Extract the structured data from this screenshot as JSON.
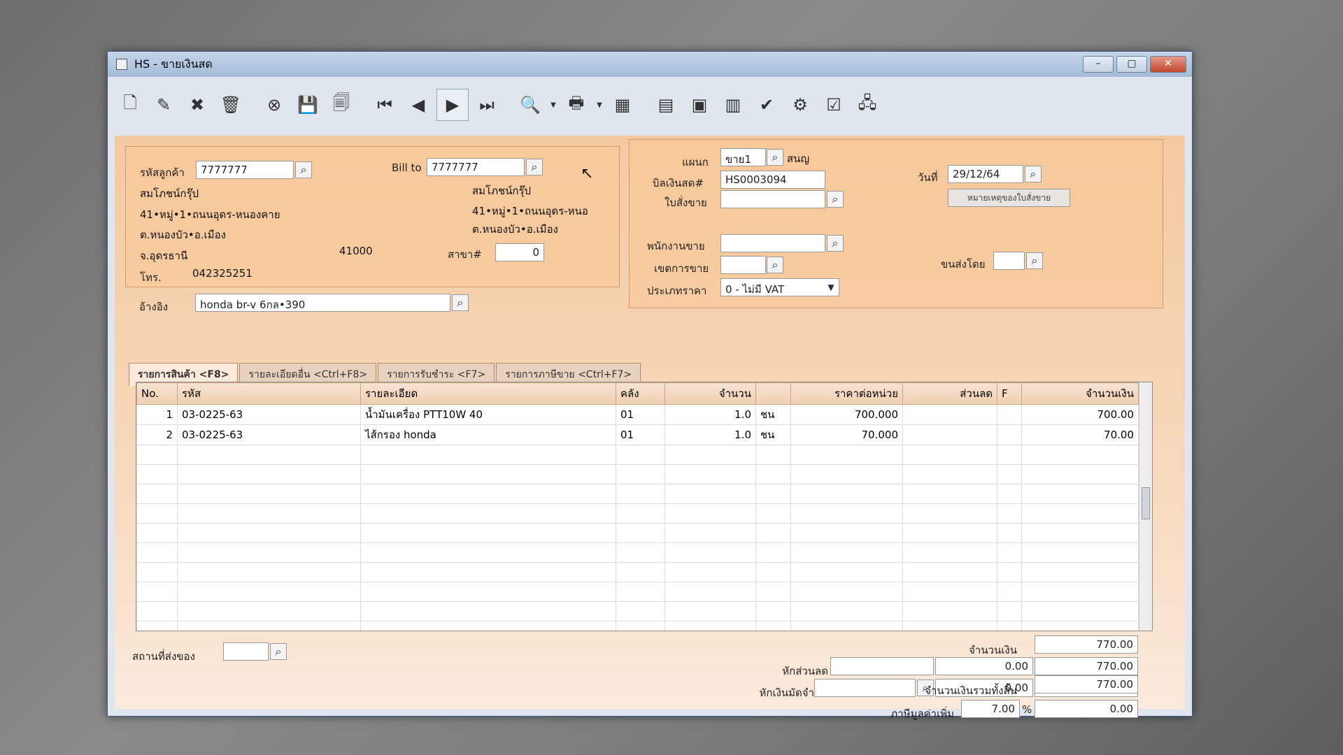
{
  "window": {
    "title": "HS - ขายเงินสด",
    "minimize": "–",
    "maximize": "▢",
    "close": "✕"
  },
  "toolbar": [
    {
      "name": "new-document-icon",
      "glyph": "🗋"
    },
    {
      "name": "edit-icon",
      "glyph": "✎"
    },
    {
      "name": "void-icon",
      "glyph": "✖"
    },
    {
      "name": "trash-icon",
      "glyph": "🗑"
    },
    {
      "name": "cancel-icon",
      "glyph": "⊗"
    },
    {
      "name": "save-icon",
      "glyph": "💾"
    },
    {
      "name": "copy-icon",
      "glyph": "🗐"
    },
    {
      "name": "first-record-icon",
      "glyph": "⏮"
    },
    {
      "name": "previous-record-icon",
      "glyph": "◀"
    },
    {
      "name": "next-record-icon",
      "glyph": "▶"
    },
    {
      "name": "last-record-icon",
      "glyph": "⏭"
    },
    {
      "name": "preview-icon",
      "glyph": "🔍"
    },
    {
      "name": "print-icon",
      "glyph": "🖶"
    },
    {
      "name": "calculator-icon",
      "glyph": "▦"
    },
    {
      "name": "form-icon",
      "glyph": "▤"
    },
    {
      "name": "money-icon",
      "glyph": "▣"
    },
    {
      "name": "register-icon",
      "glyph": "▥"
    },
    {
      "name": "approve-icon",
      "glyph": "✔"
    },
    {
      "name": "tools-icon",
      "glyph": "⚙"
    },
    {
      "name": "ok-icon",
      "glyph": "☑"
    },
    {
      "name": "network-icon",
      "glyph": "🖧"
    }
  ],
  "customer": {
    "code_label": "รหัสลูกค้า",
    "code": "7777777",
    "billto_label": "Bill to",
    "billto": "7777777",
    "name": "สมโภชน์กรุ๊ป",
    "addr1": "41•หมู่•1•ถนนอุดร-หนองคาย",
    "addr2": "ต.หนองบัว•อ.เมือง",
    "addr3": "จ.อุดรธานี",
    "zip": "41000",
    "bill_name": "สมโภชน์กรุ๊ป",
    "bill_addr1": "41•หมู่•1•ถนนอุดร-หนอ",
    "bill_addr2": "ต.หนองบัว•อ.เมือง",
    "branch_label": "สาขา#",
    "branch": "0",
    "tel_label": "โทร.",
    "tel": "042325251",
    "ref_label": "อ้างอิง",
    "ref": "honda br-v 6กล•390"
  },
  "doc": {
    "dept_label": "แผนก",
    "dept": "ขาย1",
    "dept_name": "สนญ",
    "bill_label": "บิลเงินสด#",
    "bill_no": "HS0003094",
    "date_label": "วันที่",
    "date": "29/12/64",
    "order_label": "ใบสั่งขาย",
    "order": "",
    "note_button": "หมายเหตุของใบสั่งขาย",
    "sales_label": "พนักงานขาย",
    "sales": "",
    "zone_label": "เขตการขาย",
    "zone": "",
    "ship_label": "ขนส่งโดย",
    "ship": "",
    "price_label": "ประเภทราคา",
    "price_type": "0 - ไม่มี VAT"
  },
  "tabs": [
    "รายการสินค้า <F8>",
    "รายละเอียดอื่น <Ctrl+F8>",
    "รายการรับชำระ <F7>",
    "รายการภาษีขาย <Ctrl+F7>"
  ],
  "grid": {
    "headers": [
      "No.",
      "รหัส",
      "รายละเอียด",
      "คลัง",
      "จำนวน",
      "",
      "ราคาต่อหน่วย",
      "ส่วนลด",
      "F",
      "จำนวนเงิน"
    ],
    "rows": [
      [
        "1",
        "03-0225-63",
        "น้ำมันเครื่อง PTT10W 40",
        "01",
        "1.0",
        "ชน",
        "700.000",
        "",
        "",
        "700.00"
      ],
      [
        "2",
        "03-0225-63",
        "ไส้กรอง honda",
        "01",
        "1.0",
        "ชน",
        "70.000",
        "",
        "",
        "70.00"
      ]
    ]
  },
  "footer": {
    "place_label": "สถานที่ส่งของ",
    "place": "",
    "amount_label": "จำนวนเงิน",
    "amount": "770.00",
    "discount_label": "หักส่วนลด",
    "discount_code": "",
    "discount": "0.00",
    "after_discount": "770.00",
    "deposit_label": "หักเงินมัดจำ",
    "deposit_code": "",
    "deposit": "0.00",
    "after_deposit": "770.00",
    "vat_label": "ภาษีมูลค่าเพิ่ม",
    "vat_rate": "7.00",
    "vat_unit": "%",
    "vat": "0.00",
    "total_label": "จำนวนเงินรวมทั้งสิ้น",
    "total": "770.00"
  }
}
